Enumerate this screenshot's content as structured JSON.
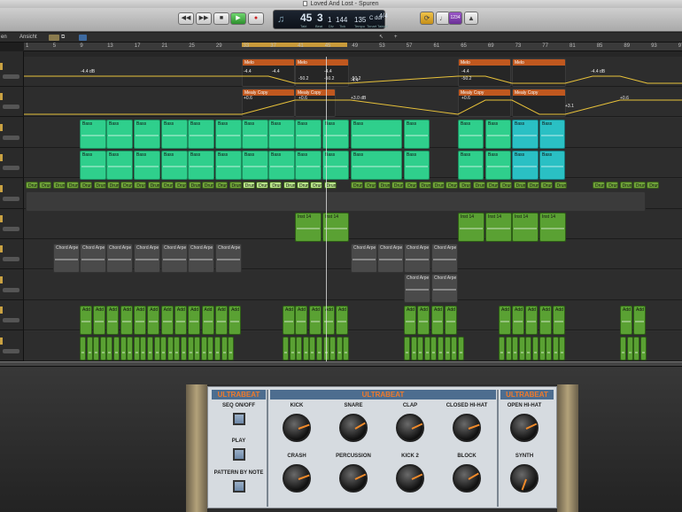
{
  "window": {
    "title": "Loved And Lost - Spuren"
  },
  "lcd": {
    "bar": "45",
    "beat": "3",
    "division": "1",
    "tick": "144",
    "tempo": "135",
    "key": "C dur",
    "signature": "4/4",
    "labels": {
      "bar": "Takt",
      "beat": "Beat",
      "division": "Div",
      "tick": "Tick",
      "tempo": "Tempo",
      "key": "Tonart",
      "signature": "Taktart"
    }
  },
  "transport": {
    "rewind": "◀◀",
    "forward": "▶▶",
    "stop": "■",
    "play": "▶",
    "record": "●",
    "counter": "1234"
  },
  "edit_menu": {
    "left": "en",
    "view": "Ansicht"
  },
  "ruler": {
    "ticks": [
      "1",
      "5",
      "9",
      "13",
      "17",
      "21",
      "25",
      "29",
      "33",
      "37",
      "41",
      "45",
      "49",
      "53",
      "57",
      "61",
      "65",
      "69",
      "73",
      "77",
      "81",
      "85",
      "89",
      "93",
      "97"
    ]
  },
  "automation": {
    "values": [
      "-4.4 dB",
      "-4.4",
      "-4.4",
      "-50.2",
      "-4.4",
      "-50.2",
      "-4.4",
      "-4.4 dB",
      "-50.2",
      "-4.4",
      "-50.2",
      "+0.6",
      "+0.6",
      "+3.0 dB",
      "+0.6",
      "+3.1",
      "+0.6"
    ]
  },
  "regions": {
    "melo": "Melo",
    "melo_copy": "Mealy Copy",
    "bass": "Bass",
    "drum": "Drum",
    "inst": "Inst 14",
    "chord": "Chord Arpe",
    "add": "Add 1"
  },
  "ultrabeat": {
    "brand": "ULTRABEAT",
    "sequencer": {
      "seq_onoff": "SEQ ON/OFF",
      "play": "PLAY",
      "pattern": "PATTERN BY NOTE"
    },
    "knobs": [
      {
        "label": "KICK",
        "rot": 70
      },
      {
        "label": "SNARE",
        "rot": 60
      },
      {
        "label": "CLAP",
        "rot": 65
      },
      {
        "label": "CLOSED HI-HAT",
        "rot": 70
      },
      {
        "label": "OPEN HI-HAT",
        "rot": 65
      },
      {
        "label": "CRASH",
        "rot": 70
      },
      {
        "label": "PERCUSSION",
        "rot": 65
      },
      {
        "label": "KICK 2",
        "rot": 65
      },
      {
        "label": "BLOCK",
        "rot": 60
      },
      {
        "label": "SYNTH",
        "rot": 200
      }
    ]
  },
  "colors": {
    "automation": "#c0581f",
    "bass": "#2fcf8c",
    "drum": "#6fa23a",
    "cycle": "#c89a3a",
    "brand_text": "#f07a2a"
  }
}
